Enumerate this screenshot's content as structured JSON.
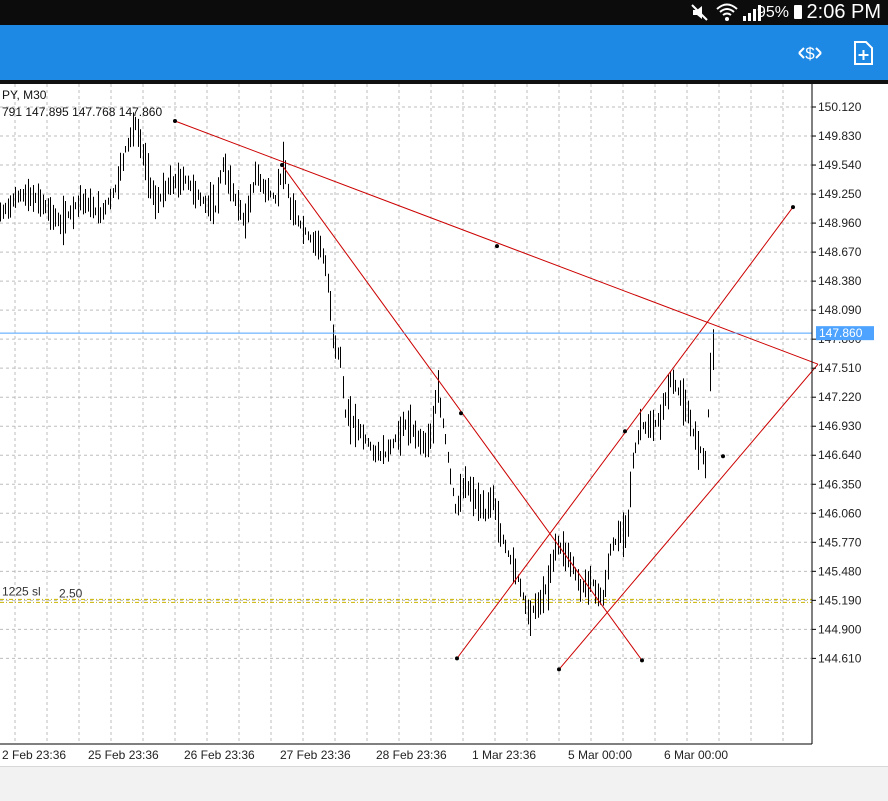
{
  "status_bar": {
    "battery_text": "95%",
    "time": "2:06 PM",
    "icons": [
      "mute-icon",
      "wifi-icon",
      "signal-icon",
      "battery-icon"
    ]
  },
  "toolbar": {
    "icons": [
      "trade-dollar-icon",
      "new-document-icon"
    ],
    "background": "#1e88e5"
  },
  "chart_data": {
    "type": "candlestick-bar",
    "symbol_line": "PY, M30",
    "ohlc_line": "791 147.895 147.768 147.860",
    "price_axis": {
      "ticks": [
        "150.120",
        "149.830",
        "149.540",
        "149.250",
        "148.960",
        "148.670",
        "148.380",
        "148.090",
        "147.800",
        "147.510",
        "147.220",
        "146.930",
        "146.640",
        "146.350",
        "146.060",
        "145.770",
        "145.480",
        "145.190",
        "144.900",
        "144.610"
      ],
      "ylim": [
        144.4,
        150.35
      ]
    },
    "time_axis": {
      "ticks": [
        "2 Feb 23:36",
        "25 Feb 23:36",
        "26 Feb 23:36",
        "27 Feb 23:36",
        "28 Feb 23:36",
        "1 Mar 23:36",
        "5 Mar 00:00",
        "6 Mar 00:00"
      ]
    },
    "current_price": {
      "label": "147.860",
      "value": 147.86,
      "color": "#4da3ff"
    },
    "order_line": {
      "label": "1225 sl",
      "size": "2.50",
      "value": 145.19,
      "color": "#c9b400"
    },
    "price_path": [
      [
        0,
        149.05
      ],
      [
        20,
        149.25
      ],
      [
        40,
        149.18
      ],
      [
        60,
        148.95
      ],
      [
        80,
        149.2
      ],
      [
        100,
        149.05
      ],
      [
        115,
        149.3
      ],
      [
        125,
        149.7
      ],
      [
        135,
        149.95
      ],
      [
        145,
        149.55
      ],
      [
        155,
        149.15
      ],
      [
        170,
        149.35
      ],
      [
        185,
        149.4
      ],
      [
        200,
        149.2
      ],
      [
        215,
        149.1
      ],
      [
        222,
        149.55
      ],
      [
        235,
        149.2
      ],
      [
        245,
        148.95
      ],
      [
        255,
        149.45
      ],
      [
        265,
        149.3
      ],
      [
        275,
        149.2
      ],
      [
        283,
        149.55
      ],
      [
        290,
        149.1
      ],
      [
        300,
        148.95
      ],
      [
        310,
        148.8
      ],
      [
        320,
        148.75
      ],
      [
        327,
        148.4
      ],
      [
        333,
        147.8
      ],
      [
        340,
        147.6
      ],
      [
        345,
        147.05
      ],
      [
        355,
        146.95
      ],
      [
        365,
        146.8
      ],
      [
        375,
        146.65
      ],
      [
        385,
        146.65
      ],
      [
        395,
        146.8
      ],
      [
        405,
        146.95
      ],
      [
        415,
        146.85
      ],
      [
        425,
        146.75
      ],
      [
        432,
        146.9
      ],
      [
        437,
        147.3
      ],
      [
        445,
        146.8
      ],
      [
        455,
        146.1
      ],
      [
        465,
        146.35
      ],
      [
        475,
        146.2
      ],
      [
        485,
        146.05
      ],
      [
        492,
        146.25
      ],
      [
        500,
        145.85
      ],
      [
        508,
        145.65
      ],
      [
        518,
        145.4
      ],
      [
        528,
        145.05
      ],
      [
        538,
        145.15
      ],
      [
        548,
        145.35
      ],
      [
        555,
        145.75
      ],
      [
        563,
        145.7
      ],
      [
        572,
        145.55
      ],
      [
        580,
        145.3
      ],
      [
        590,
        145.4
      ],
      [
        598,
        145.25
      ],
      [
        603,
        145.2
      ],
      [
        610,
        145.7
      ],
      [
        620,
        145.85
      ],
      [
        627,
        145.95
      ],
      [
        632,
        146.55
      ],
      [
        640,
        146.95
      ],
      [
        650,
        146.9
      ],
      [
        660,
        147.0
      ],
      [
        670,
        147.4
      ],
      [
        680,
        147.25
      ],
      [
        690,
        146.95
      ],
      [
        697,
        146.75
      ],
      [
        705,
        146.6
      ],
      [
        710,
        147.5
      ],
      [
        714,
        147.85
      ]
    ],
    "trendlines": [
      {
        "from": [
          175,
          149.98
        ],
        "to": [
          818,
          147.55
        ],
        "anchor": [
          497,
          148.73
        ]
      },
      {
        "from": [
          282,
          149.54
        ],
        "to": [
          642,
          144.59
        ],
        "anchor": [
          461,
          147.06
        ]
      },
      {
        "from": [
          457,
          144.61
        ],
        "to": [
          793,
          149.12
        ],
        "anchor": [
          625,
          146.88
        ]
      },
      {
        "from": [
          559,
          144.5
        ],
        "to": [
          818,
          147.55
        ],
        "anchor": [
          723,
          146.63
        ]
      }
    ],
    "line_color": "#cc0000",
    "grid": true,
    "background": "#ffffff"
  }
}
